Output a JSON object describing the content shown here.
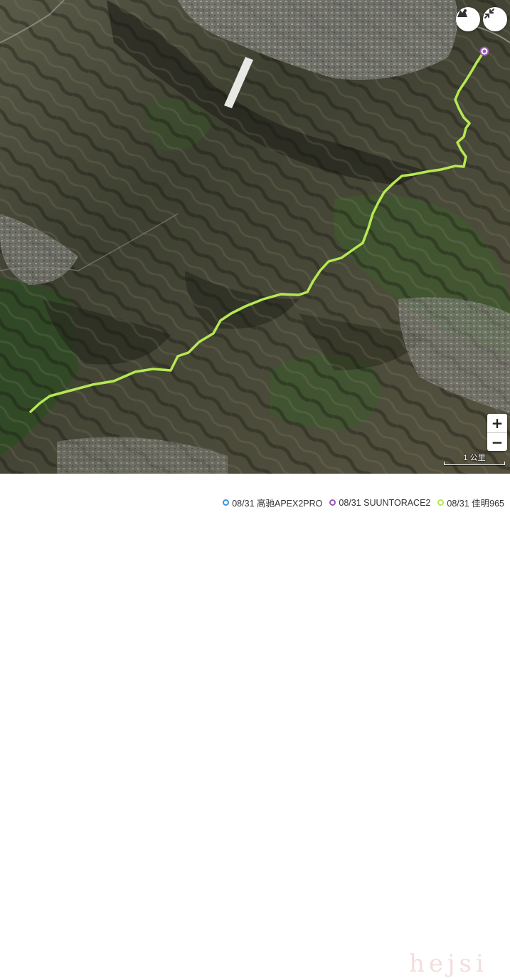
{
  "map": {
    "view": "satellite",
    "route_color": "#b5e853",
    "start_marker_color": "#9b59b6"
  },
  "controls": {
    "layers_icon": "map-layers-icon",
    "collapse_icon": "collapse-arrows-icon",
    "zoom_in_label": "+",
    "zoom_out_label": "−"
  },
  "scale": {
    "label": "1 公里"
  },
  "legend": {
    "items": [
      {
        "label": "08/31 高驰APEX2PRO",
        "color": "#3498db"
      },
      {
        "label": "08/31 SUUNTORACE2",
        "color": "#9b59b6"
      },
      {
        "label": "08/31 佳明965",
        "color": "#b5e853"
      }
    ]
  },
  "watermark": {
    "text": "hejsi"
  }
}
